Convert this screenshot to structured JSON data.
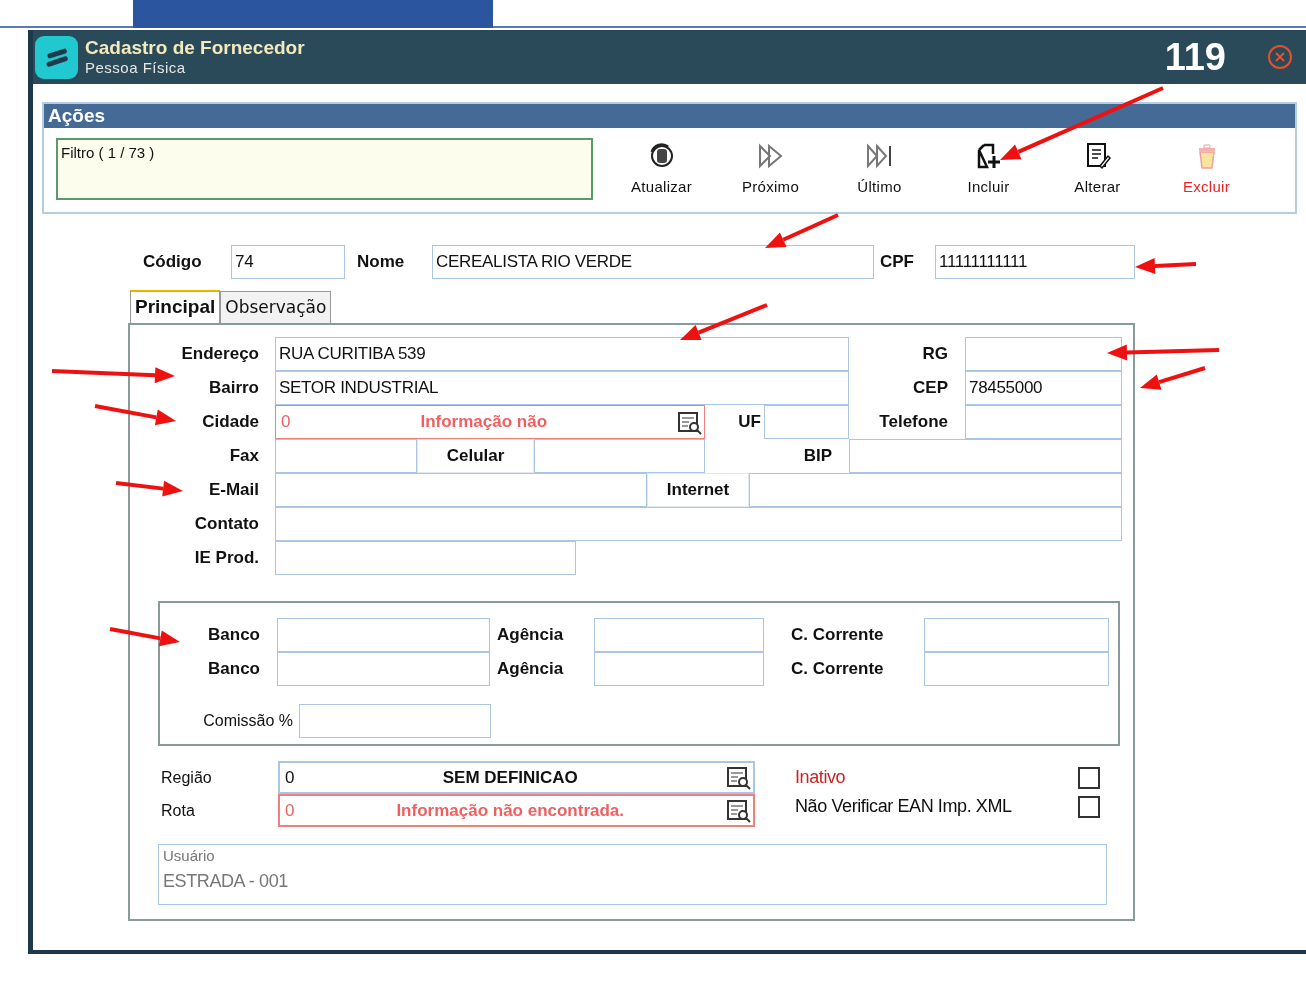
{
  "window": {
    "title": "Cadastro de Fornecedor",
    "subtitle": "Pessoa Física",
    "record_number": "119"
  },
  "actions": {
    "title": "Ações",
    "filter": "Filtro ( 1 / 73 )",
    "buttons": [
      {
        "label": "Atualizar",
        "kind": "refresh",
        "danger": false
      },
      {
        "label": "Próximo",
        "kind": "next",
        "danger": false
      },
      {
        "label": "Último",
        "kind": "last",
        "danger": false
      },
      {
        "label": "Incluir",
        "kind": "add",
        "danger": false
      },
      {
        "label": "Alterar",
        "kind": "edit",
        "danger": false
      },
      {
        "label": "Excluir",
        "kind": "delete",
        "danger": true
      }
    ]
  },
  "header_fields": [
    {
      "label": "Código",
      "value": "74"
    },
    {
      "label": "Nome",
      "value": "CEREALISTA RIO VERDE"
    },
    {
      "label": "CPF",
      "value": "11111111111"
    }
  ],
  "tabs": [
    {
      "label": "Principal",
      "selected": true
    },
    {
      "label": "Observação",
      "selected": false
    }
  ],
  "principal": {
    "rows": [
      [
        {
          "label": "Endereço",
          "value": "RUA CURITIBA 539"
        },
        {
          "label": "RG"
        }
      ],
      [
        {
          "label": "Bairro",
          "value": "SETOR INDUSTRIAL"
        },
        {
          "label": "CEP",
          "value": "78455000"
        }
      ],
      [
        {
          "label": "Cidade",
          "kind": "lookup",
          "code": "0",
          "description": "Informação não",
          "error": true
        },
        {
          "label": "UF"
        },
        {
          "label": "Telefone"
        }
      ],
      [
        {
          "label": "Fax"
        },
        {
          "label": "Celular"
        },
        {
          "label": "BIP"
        }
      ],
      [
        {
          "label": "E-Mail"
        },
        {
          "label": "Internet"
        }
      ],
      [
        {
          "label": "Contato"
        }
      ],
      [
        {
          "label": "IE Prod."
        }
      ]
    ]
  },
  "bank": {
    "rows": [
      [
        {
          "label": "Banco"
        },
        {
          "label": "Agência"
        },
        {
          "label": "C. Corrente"
        }
      ],
      [
        {
          "label": "Banco"
        },
        {
          "label": "Agência"
        },
        {
          "label": "C. Corrente"
        }
      ]
    ],
    "commission": {
      "label": "Comissão %"
    }
  },
  "lookups": [
    {
      "label": "Região",
      "code": "0",
      "description": "SEM DEFINICAO",
      "error": false
    },
    {
      "label": "Rota",
      "code": "0",
      "description": "Informação não encontrada.",
      "error": true
    }
  ],
  "options": [
    {
      "label": "Inativo",
      "checked": false,
      "highlight": true
    },
    {
      "label": "Não Verificar EAN Imp. XML",
      "checked": false,
      "highlight": false
    }
  ],
  "user": {
    "label": "Usuário",
    "value": "ESTRADA - 001"
  }
}
